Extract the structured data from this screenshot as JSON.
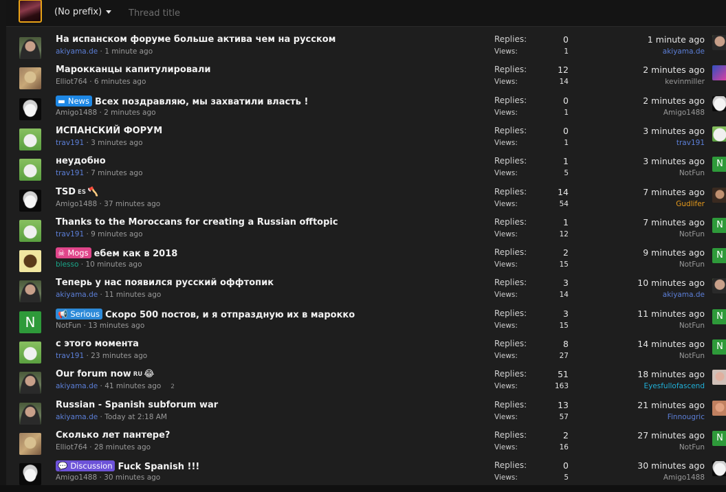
{
  "composer": {
    "prefix_select": "(No prefix)",
    "title_placeholder": "Thread title"
  },
  "labels": {
    "replies": "Replies:",
    "views": "Views:"
  },
  "prefix_colors": {
    "News": "#1e88e5",
    "Mogs": "#e0458a",
    "Serious": "#2d8ad8",
    "Discussion": "#6c52d8"
  },
  "threads": [
    {
      "avatar": "akiyama-avatar",
      "prefix": null,
      "title": "На испанском форуме больше актива чем на русском",
      "author": "akiyama.de",
      "author_color": "blue",
      "started": "1 minute ago",
      "replies": "0",
      "views": "1",
      "last_time": "1 minute ago",
      "last_user": "akiyama.de",
      "last_user_color": "blue",
      "last_avatar": "akiyama-avatar"
    },
    {
      "avatar": "elliot-avatar",
      "prefix": null,
      "title": "Марокканцы капитулировали",
      "author": "Elliot764",
      "author_color": "grey",
      "started": "6 minutes ago",
      "replies": "12",
      "views": "14",
      "last_time": "2 minutes ago",
      "last_user": "kevinmiller",
      "last_user_color": "grey",
      "last_avatar": "kevin-avatar"
    },
    {
      "avatar": "amigo-avatar",
      "prefix": {
        "label": "News",
        "icon": "newspaper-icon",
        "glyph": "▬"
      },
      "title": "Всех поздравляю, мы захватили власть !",
      "author": "Amigo1488",
      "author_color": "grey",
      "started": "2 minutes ago",
      "replies": "0",
      "views": "1",
      "last_time": "2 minutes ago",
      "last_user": "Amigo1488",
      "last_user_color": "grey",
      "last_avatar": "amigo-avatar"
    },
    {
      "avatar": "trav-avatar",
      "prefix": null,
      "title": "ИСПАНСКИЙ ФОРУМ",
      "author": "trav191",
      "author_color": "blue",
      "started": "3 minutes ago",
      "replies": "0",
      "views": "1",
      "last_time": "3 minutes ago",
      "last_user": "trav191",
      "last_user_color": "blue",
      "last_avatar": "trav-avatar"
    },
    {
      "avatar": "trav-avatar",
      "prefix": null,
      "title": "неудобно",
      "author": "trav191",
      "author_color": "blue",
      "started": "7 minutes ago",
      "replies": "1",
      "views": "5",
      "last_time": "3 minutes ago",
      "last_user": "NotFun",
      "last_user_color": "grey",
      "last_avatar": "n-avatar"
    },
    {
      "avatar": "amigo-avatar",
      "prefix": null,
      "title": "TSD",
      "tag": "ES",
      "emoji": "🪓",
      "author": "Amigo1488",
      "author_color": "grey",
      "started": "37 minutes ago",
      "replies": "14",
      "views": "54",
      "last_time": "7 minutes ago",
      "last_user": "Gudlifer",
      "last_user_color": "orange",
      "last_avatar": "gudlifer-avatar"
    },
    {
      "avatar": "trav-avatar",
      "prefix": null,
      "title": "Thanks to the Moroccans for creating a Russian offtopic",
      "author": "trav191",
      "author_color": "blue",
      "started": "9 minutes ago",
      "replies": "1",
      "views": "12",
      "last_time": "7 minutes ago",
      "last_user": "NotFun",
      "last_user_color": "grey",
      "last_avatar": "n-avatar"
    },
    {
      "avatar": "blesso-avatar",
      "prefix": {
        "label": "Mogs",
        "icon": "skull-icon",
        "glyph": "☠"
      },
      "title": "ебем как в 2018",
      "author": "blesso",
      "author_color": "teal",
      "started": "10 minutes ago",
      "replies": "2",
      "views": "15",
      "last_time": "9 minutes ago",
      "last_user": "NotFun",
      "last_user_color": "grey",
      "last_avatar": "n-avatar"
    },
    {
      "avatar": "akiyama-avatar",
      "prefix": null,
      "title": "Теперь у нас появился русский оффтопик",
      "author": "akiyama.de",
      "author_color": "blue",
      "started": "11 minutes ago",
      "replies": "3",
      "views": "14",
      "last_time": "10 minutes ago",
      "last_user": "akiyama.de",
      "last_user_color": "blue",
      "last_avatar": "akiyama-avatar"
    },
    {
      "avatar": "n-avatar",
      "prefix": {
        "label": "Serious",
        "icon": "megaphone-icon",
        "glyph": "📢"
      },
      "title": "Скоро 500 постов, и я отпраздную их в марокко",
      "author": "NotFun",
      "author_color": "grey",
      "started": "13 minutes ago",
      "replies": "3",
      "views": "15",
      "last_time": "11 minutes ago",
      "last_user": "NotFun",
      "last_user_color": "grey",
      "last_avatar": "n-avatar"
    },
    {
      "avatar": "trav-avatar",
      "prefix": null,
      "title": "с этого момента",
      "author": "trav191",
      "author_color": "blue",
      "started": "23 minutes ago",
      "replies": "8",
      "views": "27",
      "last_time": "14 minutes ago",
      "last_user": "NotFun",
      "last_user_color": "grey",
      "last_avatar": "n-avatar"
    },
    {
      "avatar": "akiyama-avatar",
      "prefix": null,
      "title": "Our forum now",
      "tag": "RU",
      "emoji": "😂",
      "author": "akiyama.de",
      "author_color": "blue",
      "started": "41 minutes ago",
      "pages": "2",
      "replies": "51",
      "views": "163",
      "last_time": "18 minutes ago",
      "last_user": "Eyesfullofascend",
      "last_user_color": "cyan",
      "last_avatar": "eyes-avatar"
    },
    {
      "avatar": "akiyama-avatar",
      "prefix": null,
      "title": "Russian - Spanish subforum war",
      "author": "akiyama.de",
      "author_color": "blue",
      "started": "Today at 2:18 AM",
      "replies": "13",
      "views": "57",
      "last_time": "21 minutes ago",
      "last_user": "Finnougric",
      "last_user_color": "blue",
      "last_avatar": "finn-avatar"
    },
    {
      "avatar": "elliot-avatar",
      "prefix": null,
      "title": "Сколько лет пантере?",
      "author": "Elliot764",
      "author_color": "grey",
      "started": "28 minutes ago",
      "replies": "2",
      "views": "16",
      "last_time": "27 minutes ago",
      "last_user": "NotFun",
      "last_user_color": "grey",
      "last_avatar": "n-avatar"
    },
    {
      "avatar": "amigo-avatar",
      "prefix": {
        "label": "Discussion",
        "icon": "chat-bubbles-icon",
        "glyph": "💬"
      },
      "title": "Fuck Spanish !!!",
      "author": "Amigo1488",
      "author_color": "grey",
      "started": "30 minutes ago",
      "replies": "0",
      "views": "5",
      "last_time": "30 minutes ago",
      "last_user": "Amigo1488",
      "last_user_color": "grey",
      "last_avatar": "amigo-avatar"
    }
  ],
  "n_letter": "N"
}
